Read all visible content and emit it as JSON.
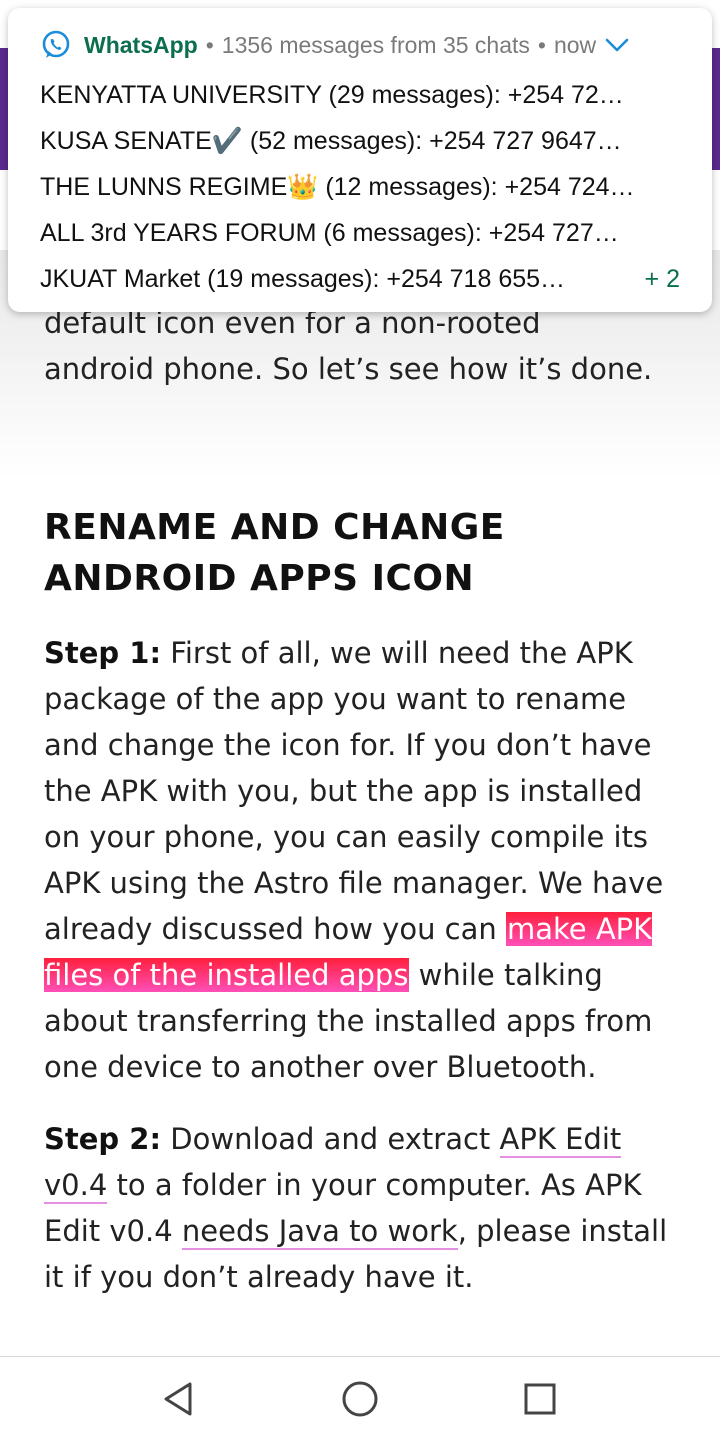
{
  "notification": {
    "app_name": "WhatsApp",
    "summary": "1356 messages from 35 chats",
    "time": "now",
    "lines": [
      "KENYATTA UNIVERSITY  (29 messages): +254 72…",
      "KUSA SENATE✔️ (52 messages): +254 727 9647…",
      "THE LUNNS REGIME👑 (12 messages): +254 724…",
      "ALL 3rd YEARS FORUM (6 messages): +254 727…",
      "JKUAT Market (19 messages): +254 718 655…"
    ],
    "more_count": "+ 2",
    "icons": {
      "app": "whatsapp-icon",
      "expand": "chevron-down-icon"
    },
    "colors": {
      "app_name": "#0b6e4f"
    }
  },
  "article": {
    "intro_line1": "default icon even for a non-rooted",
    "intro_line2": "android phone. So let’s see how it’s done.",
    "heading": "RENAME AND CHANGE ANDROID APPS ICON",
    "step1": {
      "label": "Step 1:",
      "text_before": " First of all, we will need the APK package of the app you want to rename and change the icon for. If you don’t have the APK with you, but the app is installed on your phone, you can easily compile its APK using the Astro file manager. We have already discussed how you can ",
      "link": "make APK files of the installed apps",
      "text_after": " while talking about transferring the installed apps from one device to another over Bluetooth."
    },
    "step2": {
      "label": "Step 2:",
      "text_before": " Download and extract ",
      "link1": "APK Edit v0.4",
      "text_middle": " to a folder in your computer. As APK Edit v0.4 ",
      "link2": "needs Java to work",
      "text_after": ", please install it if you don’t already have it."
    },
    "colors": {
      "highlight_start": "#ff1f3c",
      "highlight_end": "#ff4fb8",
      "link_underline": "#e58fe0"
    }
  },
  "navbar": {
    "icons": [
      "back-icon",
      "home-icon",
      "recents-icon"
    ]
  }
}
